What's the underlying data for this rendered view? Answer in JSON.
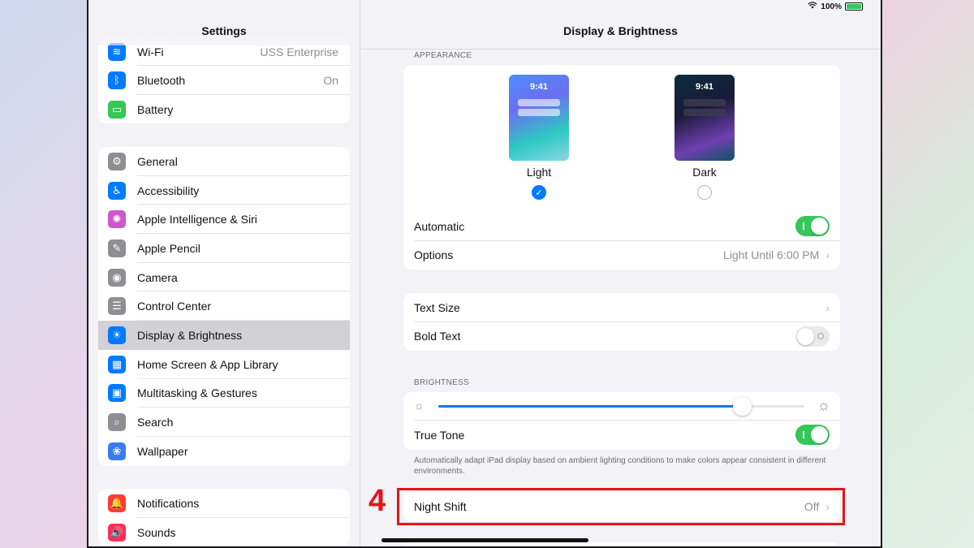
{
  "status": {
    "battery_percent": "100%"
  },
  "sidebar": {
    "title": "Settings",
    "groups": [
      [
        {
          "label": "Wi-Fi",
          "value": "USS Enterprise",
          "icon": "wifi-icon",
          "color": "#007aff",
          "glyph": "≋"
        },
        {
          "label": "Bluetooth",
          "value": "On",
          "icon": "bluetooth-icon",
          "color": "#007aff",
          "glyph": "ᛒ"
        },
        {
          "label": "Battery",
          "value": "",
          "icon": "battery-icon",
          "color": "#34c759",
          "glyph": "▭"
        }
      ],
      [
        {
          "label": "General",
          "value": "",
          "icon": "gear-icon",
          "color": "#8e8e93",
          "glyph": "⚙"
        },
        {
          "label": "Accessibility",
          "value": "",
          "icon": "accessibility-icon",
          "color": "#007aff",
          "glyph": "♿"
        },
        {
          "label": "Apple Intelligence & Siri",
          "value": "",
          "icon": "siri-icon",
          "color": "#d057c9",
          "glyph": "✺"
        },
        {
          "label": "Apple Pencil",
          "value": "",
          "icon": "pencil-icon",
          "color": "#8e8e93",
          "glyph": "✎"
        },
        {
          "label": "Camera",
          "value": "",
          "icon": "camera-icon",
          "color": "#8e8e93",
          "glyph": "◉"
        },
        {
          "label": "Control Center",
          "value": "",
          "icon": "control-center-icon",
          "color": "#8e8e93",
          "glyph": "☰"
        },
        {
          "label": "Display & Brightness",
          "value": "",
          "icon": "brightness-icon",
          "color": "#007aff",
          "glyph": "☀",
          "selected": true
        },
        {
          "label": "Home Screen & App Library",
          "value": "",
          "icon": "home-screen-icon",
          "color": "#007aff",
          "glyph": "▦"
        },
        {
          "label": "Multitasking & Gestures",
          "value": "",
          "icon": "multitasking-icon",
          "color": "#007aff",
          "glyph": "▣"
        },
        {
          "label": "Search",
          "value": "",
          "icon": "search-icon",
          "color": "#8e8e93",
          "glyph": "⌕"
        },
        {
          "label": "Wallpaper",
          "value": "",
          "icon": "wallpaper-icon",
          "color": "#3b7bf0",
          "glyph": "❀"
        }
      ],
      [
        {
          "label": "Notifications",
          "value": "",
          "icon": "notifications-icon",
          "color": "#ff3b30",
          "glyph": "🔔"
        },
        {
          "label": "Sounds",
          "value": "",
          "icon": "sounds-icon",
          "color": "#ff2d55",
          "glyph": "🔊"
        }
      ]
    ]
  },
  "detail": {
    "title": "Display & Brightness",
    "appearance_label": "APPEARANCE",
    "light_label": "Light",
    "dark_label": "Dark",
    "phone_time": "9:41",
    "automatic_label": "Automatic",
    "options_label": "Options",
    "options_value": "Light Until 6:00 PM",
    "text_size_label": "Text Size",
    "bold_text_label": "Bold Text",
    "brightness_label": "BRIGHTNESS",
    "brightness_level": 0.83,
    "true_tone_label": "True Tone",
    "true_tone_note": "Automatically adapt iPad display based on ambient lighting conditions to make colors appear consistent in different environments.",
    "night_shift_label": "Night Shift",
    "night_shift_value": "Off"
  },
  "annotation": {
    "step": "4",
    "color": "#e3141a"
  }
}
